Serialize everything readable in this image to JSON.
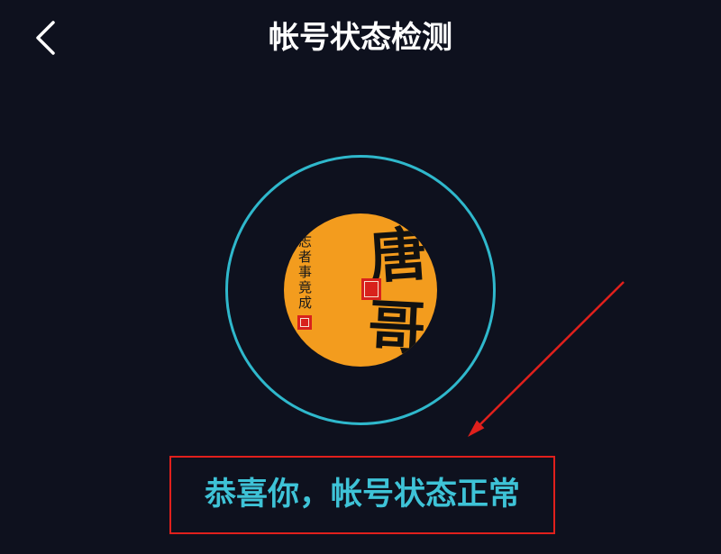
{
  "header": {
    "title": "帐号状态检测",
    "back_icon": "chevron-left-icon"
  },
  "avatar": {
    "char_top": "唐",
    "char_bottom": "哥",
    "motto": "有志者事竟成"
  },
  "status": {
    "message": "恭喜你，帐号状态正常"
  },
  "colors": {
    "background": "#0e111e",
    "ring": "#2fb8cc",
    "avatar": "#f39c1e",
    "message": "#3ec3d7",
    "annotation": "#e0201c"
  }
}
